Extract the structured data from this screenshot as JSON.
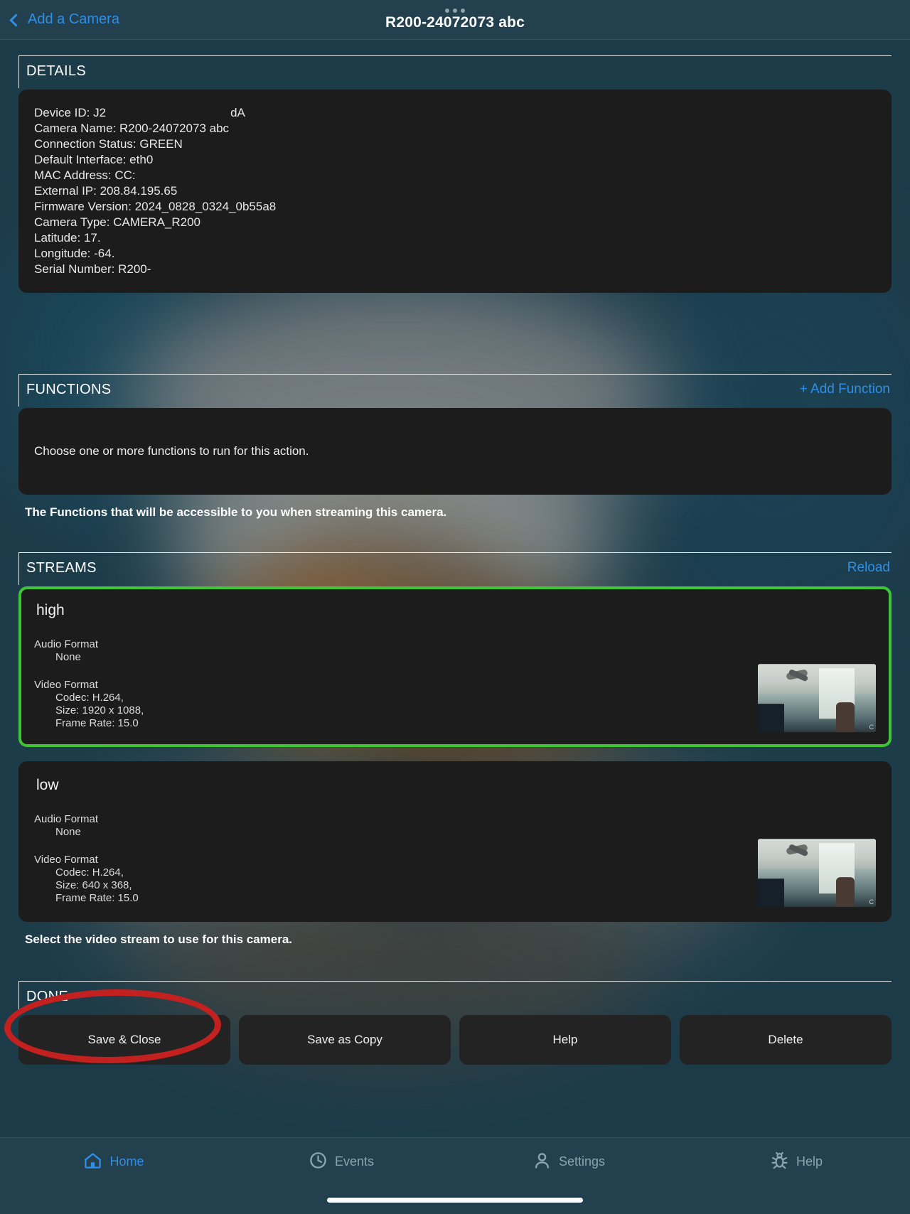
{
  "navbar": {
    "back_label": "Add a Camera",
    "back_icon": "chevron-left-icon",
    "title": "R200-24072073 abc",
    "menu_dots_icon": "more-dots-icon"
  },
  "details": {
    "section_title": "DETAILS",
    "rows": [
      {
        "label": "Device ID:",
        "value": "J2",
        "extra": "dA"
      },
      {
        "label": "Camera Name:",
        "value": "R200-24072073 abc",
        "extra": ""
      },
      {
        "label": "Connection Status:",
        "value": "GREEN",
        "extra": ""
      },
      {
        "label": "Default Interface:",
        "value": "eth0",
        "extra": ""
      },
      {
        "label": "MAC Address:",
        "value": "CC:",
        "extra": ""
      },
      {
        "label": "External IP:",
        "value": "208.84.195.65",
        "extra": ""
      },
      {
        "label": "Firmware Version:",
        "value": "2024_0828_0324_0b55a8",
        "extra": ""
      },
      {
        "label": "Camera Type:",
        "value": "CAMERA_R200",
        "extra": ""
      },
      {
        "label": "Latitude:",
        "value": "17.",
        "extra": ""
      },
      {
        "label": "Longitude:",
        "value": "-64.",
        "extra": ""
      },
      {
        "label": "Serial Number:",
        "value": "R200-",
        "extra": ""
      }
    ],
    "line0": "Device ID: J2",
    "line0_extra": "dA",
    "line1": "Camera Name: R200-24072073 abc",
    "line2": "Connection Status: GREEN",
    "line3": "Default Interface: eth0",
    "line4": "MAC Address: CC:",
    "line5": "External IP: 208.84.195.65",
    "line6": "Firmware Version: 2024_0828_0324_0b55a8",
    "line7": "Camera Type: CAMERA_R200",
    "line8": "Latitude: 17.",
    "line9": "Longitude: -64.",
    "line10": "Serial Number: R200-"
  },
  "functions": {
    "section_title": "FUNCTIONS",
    "add_label": "+ Add Function",
    "body_text": "Choose one or more functions to run for this action.",
    "helper_text": "The Functions that will be accessible to you when streaming this camera."
  },
  "streams": {
    "section_title": "STREAMS",
    "reload_label": "Reload",
    "helper_text": "Select the video stream to use for this camera.",
    "selected_border_color": "#3fc436",
    "items": [
      {
        "name": "high",
        "selected": true,
        "audio_label": "Audio Format",
        "audio_value": "None",
        "video_label": "Video Format",
        "codec": "Codec: H.264,",
        "size": "Size: 1920 x 1088,",
        "frame_rate": "Frame Rate: 15.0",
        "thumbnail_caption": "C"
      },
      {
        "name": "low",
        "selected": false,
        "audio_label": "Audio Format",
        "audio_value": "None",
        "video_label": "Video Format",
        "codec": "Codec: H.264,",
        "size": "Size: 640 x 368,",
        "frame_rate": "Frame Rate: 15.0",
        "thumbnail_caption": "C"
      }
    ]
  },
  "done": {
    "section_title": "DONE",
    "buttons": [
      {
        "label": "Save & Close"
      },
      {
        "label": "Save as Copy"
      },
      {
        "label": "Help"
      },
      {
        "label": "Delete"
      }
    ]
  },
  "annotation": {
    "shape": "ellipse",
    "color": "#c32020",
    "targets": "Save & Close"
  },
  "tabbar": {
    "items": [
      {
        "label": "Home",
        "icon": "home-icon",
        "active": true
      },
      {
        "label": "Events",
        "icon": "clock-icon",
        "active": false
      },
      {
        "label": "Settings",
        "icon": "person-icon",
        "active": false
      },
      {
        "label": "Help",
        "icon": "bug-icon",
        "active": false
      }
    ],
    "active_color": "#2f8fe8",
    "inactive_color": "#8ba4af"
  }
}
